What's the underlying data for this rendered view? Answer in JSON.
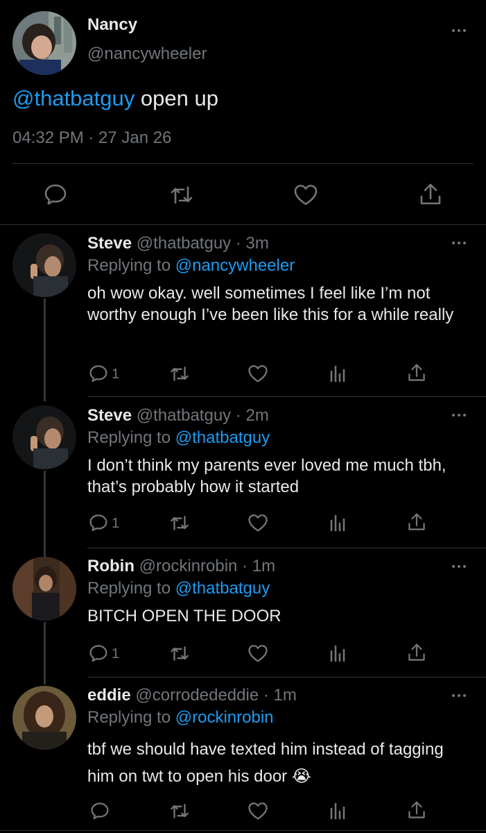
{
  "main_tweet": {
    "name": "Nancy",
    "handle": "@nancywheeler",
    "mention": "@thatbatguy",
    "text": " open up",
    "timestamp": "04:32 PM · 27 Jan 26"
  },
  "replies": [
    {
      "name": "Steve",
      "meta": "@thatbatguy · 3m",
      "replying_prefix": "Replying to ",
      "replying_to": "@nancywheeler",
      "text": "oh wow okay. well sometimes I feel like I’m not worthy enough I’ve been like this for a while really",
      "reply_count": "1"
    },
    {
      "name": "Steve",
      "meta": "@thatbatguy · 2m",
      "replying_prefix": "Replying to ",
      "replying_to": "@thatbatguy",
      "text": "I don’t think my parents ever loved me much tbh, that’s probably how it started",
      "reply_count": "1"
    },
    {
      "name": "Robin",
      "meta": "@rockinrobin · 1m",
      "replying_prefix": "Replying to ",
      "replying_to": "@thatbatguy",
      "text": "BITCH OPEN THE DOOR",
      "reply_count": "1"
    },
    {
      "name": "eddie",
      "meta": "@corrodededdie · 1m",
      "replying_prefix": "Replying to ",
      "replying_to": "@rockinrobin",
      "text": "tbf we should have texted him instead of tagging him on twt to open his door 😭",
      "reply_count": ""
    }
  ],
  "colors": {
    "background": "#000000",
    "text": "#e7e9ea",
    "muted": "#71767b",
    "link": "#1d9bf0",
    "divider": "#2f3336"
  },
  "icons": [
    "reply-icon",
    "retweet-icon",
    "like-icon",
    "views-icon",
    "share-icon",
    "more-icon",
    "crying-emoji"
  ]
}
